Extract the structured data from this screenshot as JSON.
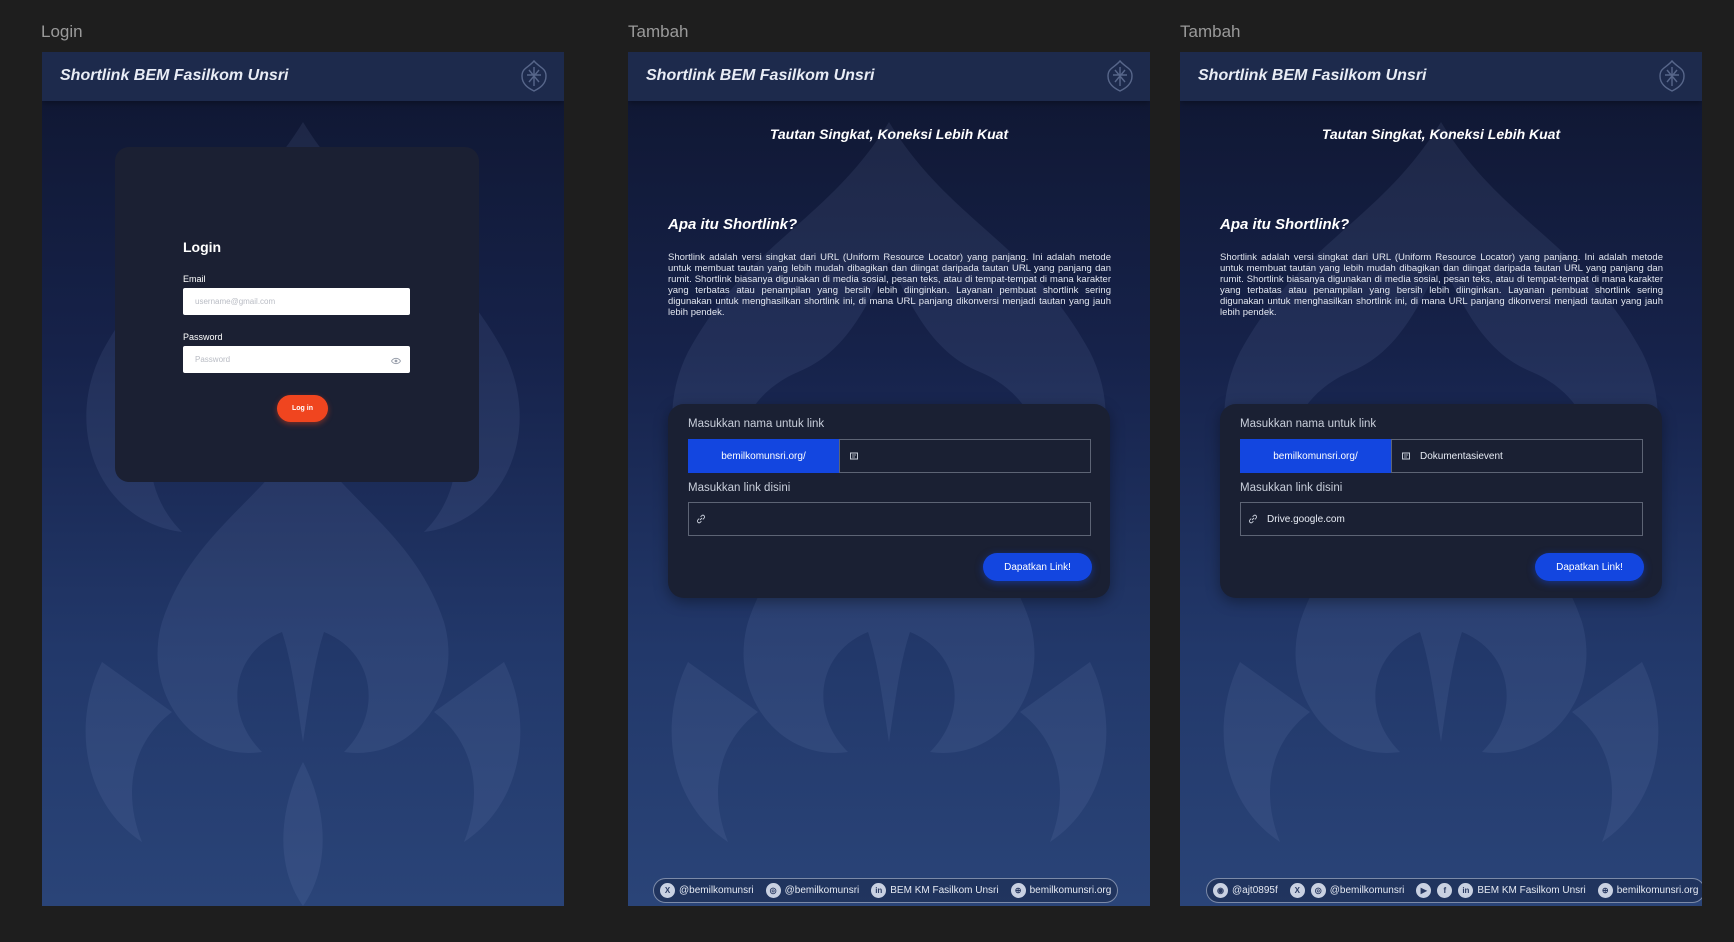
{
  "frames": {
    "login": {
      "label": "Login"
    },
    "tambah_empty": {
      "label": "Tambah"
    },
    "tambah_filled": {
      "label": "Tambah"
    }
  },
  "header": {
    "title": "Shortlink BEM Fasilkom Unsri"
  },
  "login": {
    "title": "Login",
    "email_label": "Email",
    "email_placeholder": "username@gmail.com",
    "password_label": "Password",
    "password_placeholder": "Password",
    "button_label": "Log in"
  },
  "tambah": {
    "tagline": "Tautan Singkat, Koneksi Lebih Kuat",
    "section_title": "Apa itu Shortlink?",
    "description": "Shortlink adalah versi singkat dari URL (Uniform Resource Locator) yang panjang. Ini adalah metode untuk membuat tautan yang lebih mudah dibagikan dan diingat daripada tautan URL yang panjang dan rumit. Shortlink biasanya digunakan di media sosial, pesan teks, atau di tempat-tempat di mana karakter yang terbatas atau penampilan yang bersih lebih diinginkan. Layanan pembuat shortlink sering digunakan untuk menghasilkan shortlink ini, di mana URL panjang dikonversi menjadi tautan yang jauh lebih pendek.",
    "name_label": "Masukkan nama untuk link",
    "domain_prefix": "bemilkomunsri.org/",
    "link_label": "Masukkan link disini",
    "button_label": "Dapatkan Link!"
  },
  "filled": {
    "name_value": "Dokumentasievent",
    "link_value": "Drive.google.com"
  },
  "footer_empty": [
    {
      "icon": "x-twitter-icon",
      "glyph": "X",
      "text": "@bemilkomunsri"
    },
    {
      "icon": "instagram-icon",
      "glyph": "◎",
      "text": "@bemilkomunsri"
    },
    {
      "icon": "linkedin-icon",
      "glyph": "in",
      "text": "BEM KM Fasilkom Unsri"
    },
    {
      "icon": "globe-icon",
      "glyph": "⊕",
      "text": "bemilkomunsri.org"
    }
  ],
  "footer_filled": [
    {
      "icon": "discord-icon",
      "glyph": "◉",
      "text": "@ajt0895f"
    },
    {
      "icon": "x-twitter-icon",
      "glyph": "X",
      "text": ""
    },
    {
      "icon": "instagram-icon",
      "glyph": "◎",
      "text": "@bemilkomunsri"
    },
    {
      "icon": "youtube-icon",
      "glyph": "▶",
      "text": ""
    },
    {
      "icon": "facebook-icon",
      "glyph": "f",
      "text": ""
    },
    {
      "icon": "linkedin-icon",
      "glyph": "in",
      "text": "BEM KM Fasilkom Unsri"
    },
    {
      "icon": "globe-icon",
      "glyph": "⊕",
      "text": "bemilkomunsri.org"
    }
  ],
  "colors": {
    "canvas": "#1e1e1e",
    "header": "#1d2a4c",
    "accent_blue": "#1346e0",
    "accent_orange": "#f0451f",
    "card": "#1a2033"
  }
}
